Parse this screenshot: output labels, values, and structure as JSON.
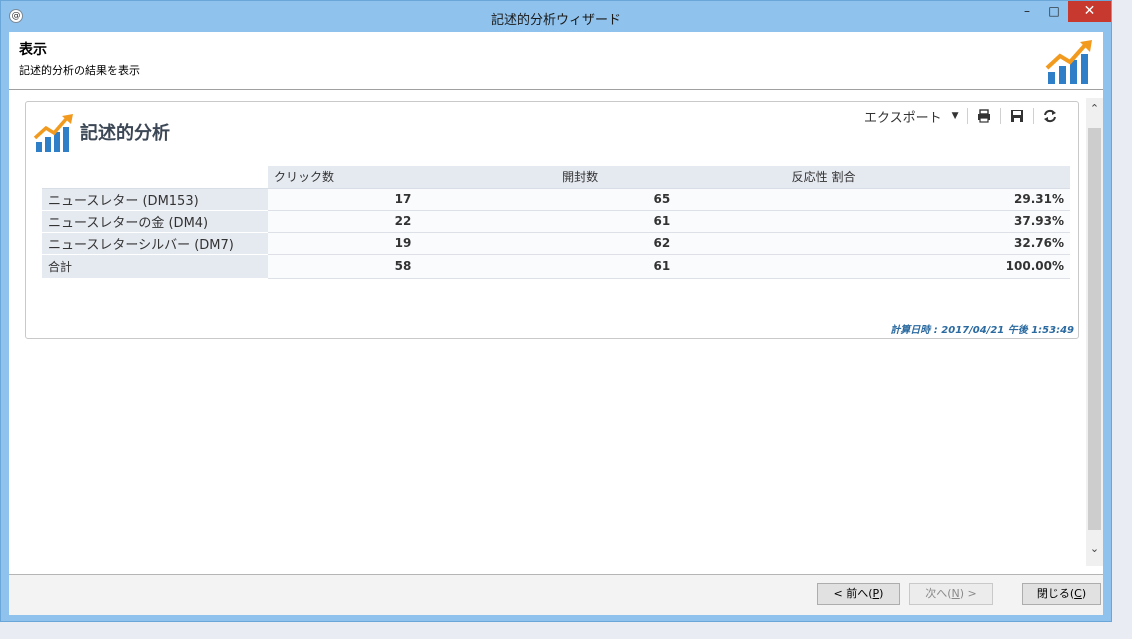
{
  "window": {
    "title": "記述的分析ウィザード",
    "minimize": "–",
    "maximize": "□",
    "close": "✕"
  },
  "header": {
    "title": "表示",
    "subtitle": "記述的分析の結果を表示"
  },
  "panel": {
    "title": "記述的分析",
    "toolbar": {
      "export_label": "エクスポート"
    },
    "table": {
      "columns": [
        "クリック数",
        "開封数",
        "反応性 割合"
      ],
      "rows": [
        {
          "label": "ニュースレター (DM153)",
          "clicks": "17",
          "opens": "65",
          "ratio": "29.31%"
        },
        {
          "label": "ニュースレターの金 (DM4)",
          "clicks": "22",
          "opens": "61",
          "ratio": "37.93%"
        },
        {
          "label": "ニュースレターシルバー (DM7)",
          "clicks": "19",
          "opens": "62",
          "ratio": "32.76%"
        }
      ],
      "total": {
        "label": "合計",
        "clicks": "58",
        "opens": "61",
        "ratio": "100.00%"
      }
    },
    "calc_time": "計算日時 : 2017/04/21 午後 1:53:49"
  },
  "footer": {
    "prev": "< 前へ(",
    "prev_key": "P",
    "next": "次へ(",
    "next_key": "N",
    "next_suffix": ") >",
    "close": "閉じる(",
    "close_key": "C"
  },
  "colors": {
    "accent_blue": "#2f7fc8",
    "accent_orange": "#f29a1e",
    "calc_time": "#2a6aa0"
  }
}
